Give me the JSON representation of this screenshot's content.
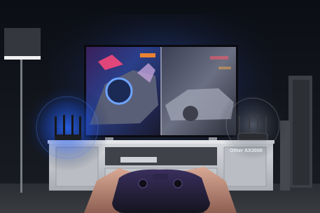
{
  "image": {
    "kind": "product-photo",
    "router_label": "Other AX3000",
    "colors": {
      "room_dark": "#0d1118",
      "backlight": "#2a6cff",
      "tv_panel": "#0a0a10",
      "cabinet": "#c9ccd1",
      "controller": "#1c1d2a"
    }
  }
}
